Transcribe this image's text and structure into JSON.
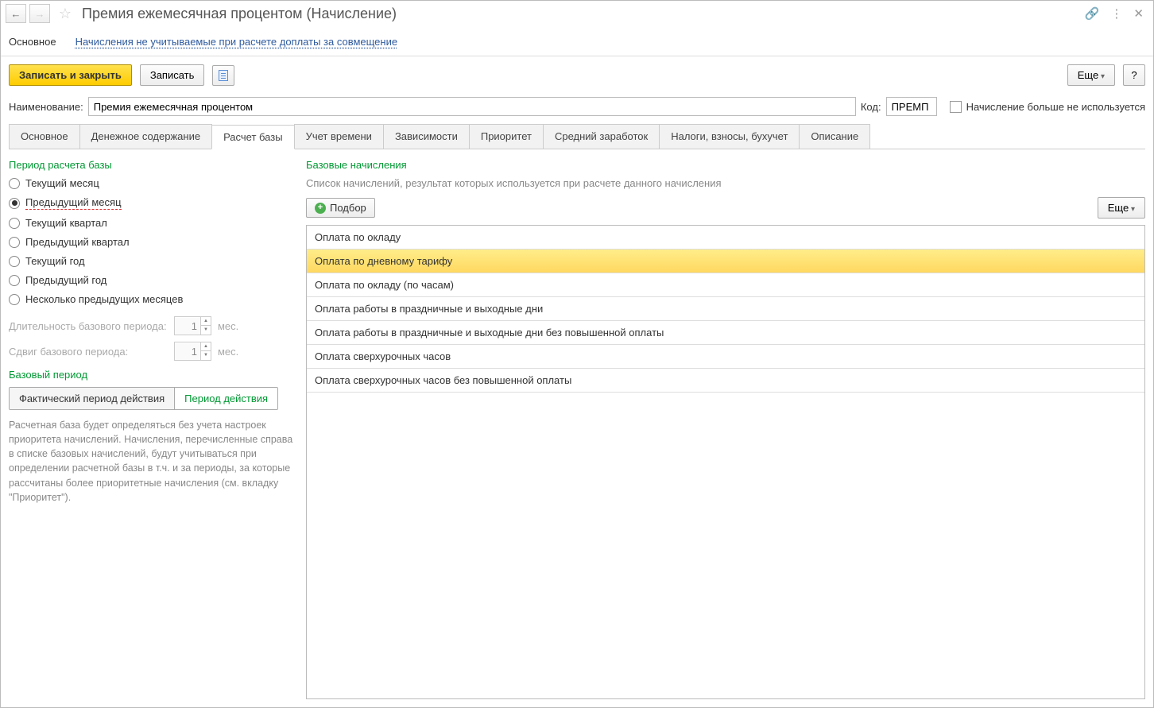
{
  "title": "Премия ежемесячная процентом (Начисление)",
  "navTabs": {
    "main": "Основное",
    "link": "Начисления не учитываемые при расчете доплаты за совмещение"
  },
  "toolbar": {
    "saveClose": "Записать и закрыть",
    "save": "Записать",
    "more": "Еще",
    "help": "?"
  },
  "fields": {
    "nameLabel": "Наименование:",
    "nameValue": "Премия ежемесячная процентом",
    "codeLabel": "Код:",
    "codeValue": "ПРЕМП",
    "noLongerUsed": "Начисление больше не используется"
  },
  "innerTabs": [
    "Основное",
    "Денежное содержание",
    "Расчет базы",
    "Учет времени",
    "Зависимости",
    "Приоритет",
    "Средний заработок",
    "Налоги, взносы, бухучет",
    "Описание"
  ],
  "activeInnerTab": 2,
  "leftPanel": {
    "periodTitle": "Период расчета базы",
    "radioOptions": [
      "Текущий месяц",
      "Предыдущий месяц",
      "Текущий квартал",
      "Предыдущий квартал",
      "Текущий год",
      "Предыдущий год",
      "Несколько предыдущих месяцев"
    ],
    "selectedRadio": 1,
    "durationLabel": "Длительность базового периода:",
    "durationValue": "1",
    "durationUnit": "мес.",
    "offsetLabel": "Сдвиг базового периода:",
    "offsetValue": "1",
    "offsetUnit": "мес.",
    "basePeriodTitle": "Базовый период",
    "toggle1": "Фактический период действия",
    "toggle2": "Период действия",
    "info": "Расчетная база будет определяться без учета настроек приоритета начислений. Начисления, перечисленные справа в списке базовых начислений, будут учитываться при определении расчетной базы в т.ч. и за периоды, за которые рассчитаны более приоритетные начисления (см. вкладку \"Приоритет\")."
  },
  "rightPanel": {
    "title": "Базовые начисления",
    "hint": "Список начислений, результат которых используется при расчете данного начисления",
    "selectBtn": "Подбор",
    "more": "Еще",
    "items": [
      "Оплата по окладу",
      "Оплата по дневному тарифу",
      "Оплата по окладу (по часам)",
      "Оплата работы в праздничные и выходные дни",
      "Оплата работы в праздничные и выходные дни без повышенной оплаты",
      "Оплата сверхурочных часов",
      "Оплата сверхурочных часов без повышенной оплаты"
    ],
    "selectedItem": 1
  }
}
